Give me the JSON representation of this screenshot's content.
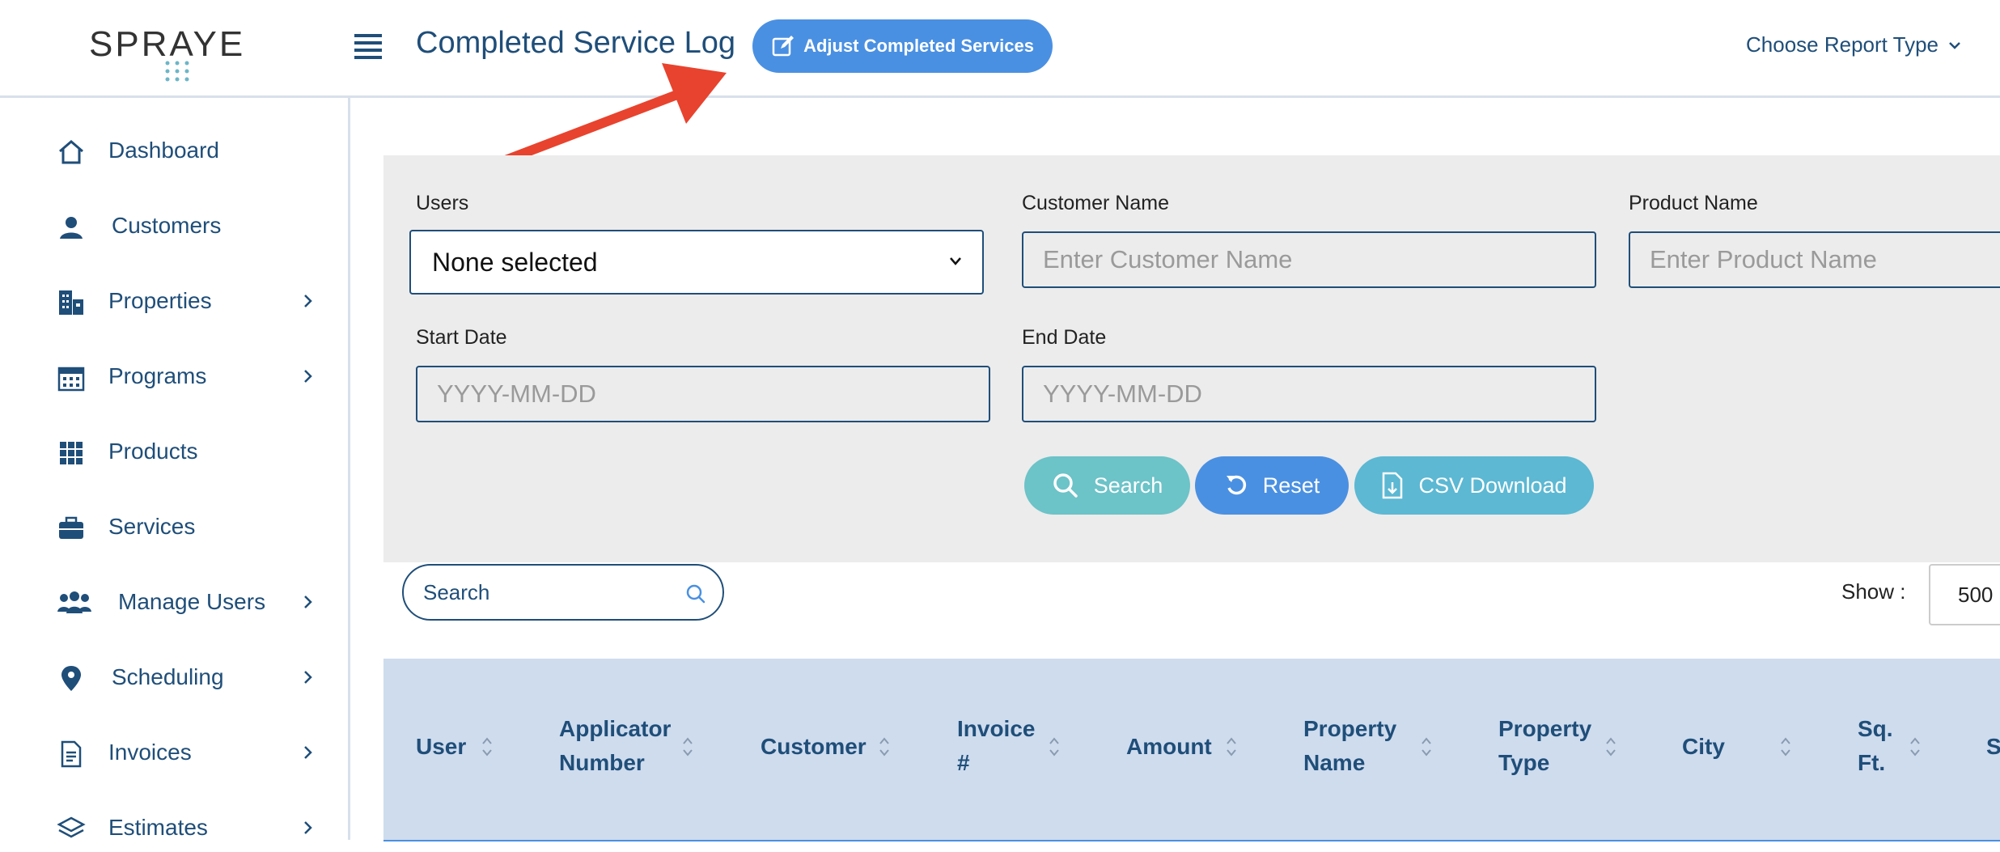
{
  "header": {
    "logo_text": "SPRAYE",
    "title": "Completed Service Log",
    "adjust_button": "Adjust Completed Services",
    "report_type": "Choose Report Type"
  },
  "sidebar": {
    "items": [
      {
        "label": "Dashboard",
        "icon": "home-icon",
        "has_submenu": false
      },
      {
        "label": "Customers",
        "icon": "customer-icon",
        "has_submenu": false
      },
      {
        "label": "Properties",
        "icon": "building-icon",
        "has_submenu": true
      },
      {
        "label": "Programs",
        "icon": "calendar-icon",
        "has_submenu": true
      },
      {
        "label": "Products",
        "icon": "grid-icon",
        "has_submenu": false
      },
      {
        "label": "Services",
        "icon": "briefcase-icon",
        "has_submenu": false
      },
      {
        "label": "Manage Users",
        "icon": "users-icon",
        "has_submenu": true
      },
      {
        "label": "Scheduling",
        "icon": "map-pin-icon",
        "has_submenu": true
      },
      {
        "label": "Invoices",
        "icon": "document-icon",
        "has_submenu": true
      },
      {
        "label": "Estimates",
        "icon": "layers-icon",
        "has_submenu": true
      }
    ]
  },
  "filters": {
    "users_label": "Users",
    "users_value": "None selected",
    "customer_label": "Customer Name",
    "customer_placeholder": "Enter Customer Name",
    "product_label": "Product Name",
    "product_placeholder": "Enter Product Name",
    "start_label": "Start Date",
    "start_placeholder": "YYYY-MM-DD",
    "end_label": "End Date",
    "end_placeholder": "YYYY-MM-DD",
    "search_button": "Search",
    "reset_button": "Reset",
    "csv_button": "CSV Download"
  },
  "table": {
    "search_placeholder": "Search",
    "show_label": "Show :",
    "show_value": "500",
    "columns": [
      {
        "line1": "User",
        "line2": ""
      },
      {
        "line1": "Applicator",
        "line2": "Number"
      },
      {
        "line1": "Customer",
        "line2": ""
      },
      {
        "line1": "Invoice",
        "line2": "#"
      },
      {
        "line1": "Amount",
        "line2": ""
      },
      {
        "line1": "Property",
        "line2": "Name"
      },
      {
        "line1": "Property",
        "line2": "Type"
      },
      {
        "line1": "City",
        "line2": ""
      },
      {
        "line1": "Sq.",
        "line2": "Ft."
      },
      {
        "line1": "S",
        "line2": ""
      }
    ]
  },
  "colors": {
    "primary": "#1f4e79",
    "accent_blue": "#4a90e2",
    "teal": "#6cc3c8",
    "annotation_red": "#e8432e",
    "panel_gray": "#ececec",
    "table_header": "#cfdcee"
  }
}
